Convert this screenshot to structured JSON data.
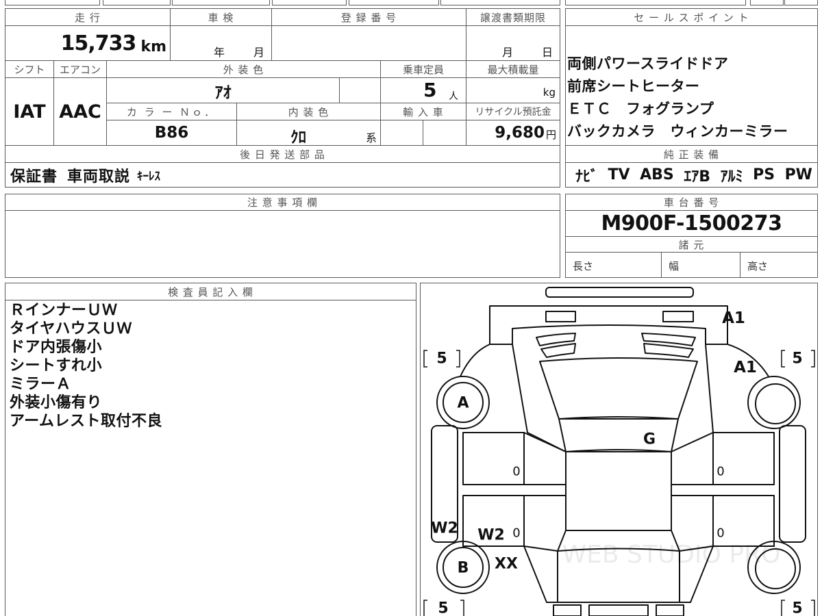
{
  "vehicle_info": {
    "mileage": {
      "label": "走 行",
      "value": "15,733",
      "unit": "km"
    },
    "shaken": {
      "label": "車 検",
      "year_unit": "年",
      "month_unit": "月"
    },
    "registration_number": {
      "label": "登 録 番 号",
      "value": ""
    },
    "transfer_document_deadline": {
      "label": "譲渡書類期限",
      "month_unit": "月",
      "day_unit": "日"
    },
    "shift": {
      "label": "シフト",
      "value": "IAT"
    },
    "air_conditioner": {
      "label": "エアコン",
      "value": "AAC"
    },
    "exterior_color": {
      "label": "外 装 色",
      "value": "ｱｵ"
    },
    "seating_capacity": {
      "label": "乗車定員",
      "value": "5",
      "unit": "人"
    },
    "max_load": {
      "label": "最大積載量",
      "value": "",
      "unit": "kg"
    },
    "color_number": {
      "label": "カ ラ ー Ｎｏ．",
      "value": "B86"
    },
    "interior_color": {
      "label": "内 装 色",
      "value": "ｸﾛ",
      "suffix": "系"
    },
    "imported": {
      "label": "輸 入 車"
    },
    "recycle_deposit": {
      "label": "リサイクル預託金",
      "value": "9,680",
      "unit": "円"
    },
    "later_shipping_parts": {
      "label": "後 日 発 送 部 品",
      "items": [
        "保証書",
        "車両取説",
        "ｷｰﾚｽ"
      ]
    }
  },
  "sales_points": {
    "label": "セ ー ル ス ポ イ ン ト",
    "items": [
      "両側パワースライドドア",
      "前席シートヒーター",
      "ＥＴＣ　フォグランプ",
      "バックカメラ　ウィンカーミラー"
    ]
  },
  "factory_equipment": {
    "label": "純 正 装 備",
    "items": [
      "ﾅﾋﾞ",
      "TV",
      "ABS",
      "ｴｱB",
      "ｱﾙﾐ",
      "PS",
      "PW"
    ]
  },
  "notes": {
    "label": "注 意 事 項 欄",
    "value": ""
  },
  "chassis": {
    "label": "車 台 番 号",
    "value": "M900F-1500273"
  },
  "specifications": {
    "label": "諸 元",
    "length_label": "長さ",
    "width_label": "幅",
    "height_label": "高さ"
  },
  "inspector_notes": {
    "label": "検 査 員 記 入 欄",
    "items": [
      "ＲインナーＵＷ",
      "タイヤハウスＵＷ",
      "ドア内張傷小",
      "シートすれ小",
      "ミラーＡ",
      "外装小傷有り",
      "アームレスト取付不良"
    ]
  },
  "condition_diagram": {
    "marks": {
      "hood_right": "A1",
      "front_right_fender": "A1",
      "front_left_wheel": "A",
      "roof_front": "G",
      "left_front_door": "0",
      "right_front_door": "0",
      "left_rear_door": "0",
      "right_rear_door": "0",
      "left_side_sill": "W2",
      "left_rear_quarter": "W2",
      "rear_left_wheel": "B",
      "rear_left_panel": "XX"
    },
    "tire_tread": {
      "front_left": "5",
      "front_right": "5",
      "rear_left": "5",
      "rear_right": "5"
    },
    "watermark": "WEB STUDIO PRO"
  }
}
